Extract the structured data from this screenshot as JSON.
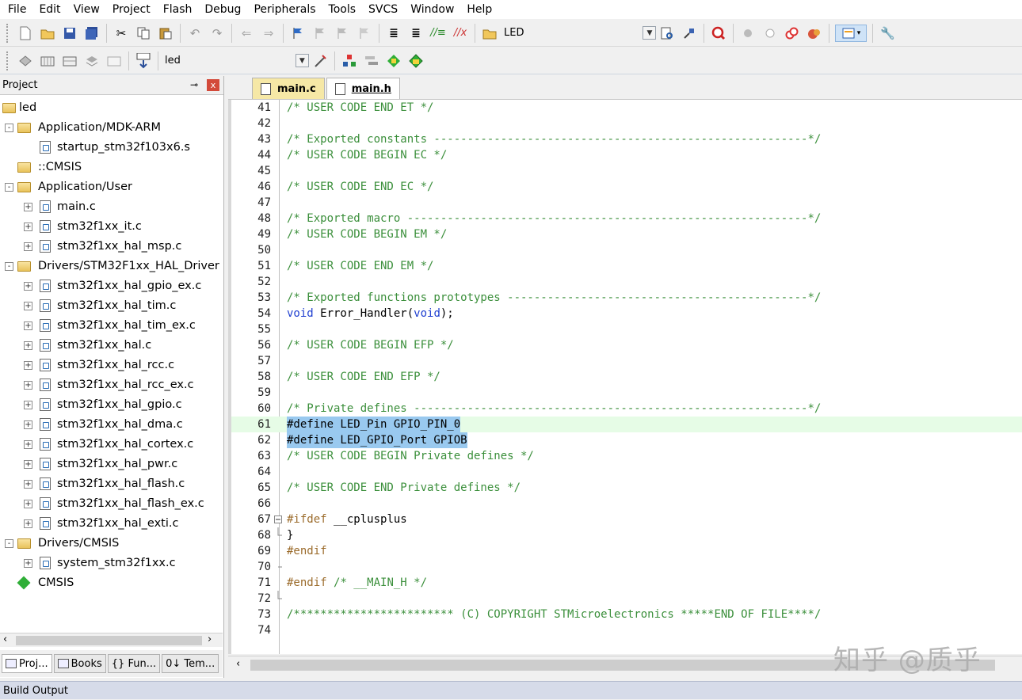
{
  "menu": [
    "File",
    "Edit",
    "View",
    "Project",
    "Flash",
    "Debug",
    "Peripherals",
    "Tools",
    "SVCS",
    "Window",
    "Help"
  ],
  "toolbar1": {
    "target_label": "LED"
  },
  "toolbar2": {
    "target_label": "led"
  },
  "project_panel": {
    "title": "Project",
    "pin": "ᵖ",
    "close": "x",
    "tree": [
      {
        "label": "led",
        "level": 0,
        "type": "root",
        "expander": ""
      },
      {
        "label": "Application/MDK-ARM",
        "level": 1,
        "type": "folder",
        "expander": "-"
      },
      {
        "label": "startup_stm32f103x6.s",
        "level": 2,
        "type": "file",
        "expander": ""
      },
      {
        "label": "::CMSIS",
        "level": 1,
        "type": "folder",
        "expander": ""
      },
      {
        "label": "Application/User",
        "level": 1,
        "type": "folder",
        "expander": "-"
      },
      {
        "label": "main.c",
        "level": 2,
        "type": "file",
        "expander": "+"
      },
      {
        "label": "stm32f1xx_it.c",
        "level": 2,
        "type": "file",
        "expander": "+"
      },
      {
        "label": "stm32f1xx_hal_msp.c",
        "level": 2,
        "type": "file",
        "expander": "+"
      },
      {
        "label": "Drivers/STM32F1xx_HAL_Driver",
        "level": 1,
        "type": "folder",
        "expander": "-"
      },
      {
        "label": "stm32f1xx_hal_gpio_ex.c",
        "level": 2,
        "type": "file",
        "expander": "+"
      },
      {
        "label": "stm32f1xx_hal_tim.c",
        "level": 2,
        "type": "file",
        "expander": "+"
      },
      {
        "label": "stm32f1xx_hal_tim_ex.c",
        "level": 2,
        "type": "file",
        "expander": "+"
      },
      {
        "label": "stm32f1xx_hal.c",
        "level": 2,
        "type": "file",
        "expander": "+"
      },
      {
        "label": "stm32f1xx_hal_rcc.c",
        "level": 2,
        "type": "file",
        "expander": "+"
      },
      {
        "label": "stm32f1xx_hal_rcc_ex.c",
        "level": 2,
        "type": "file",
        "expander": "+"
      },
      {
        "label": "stm32f1xx_hal_gpio.c",
        "level": 2,
        "type": "file",
        "expander": "+"
      },
      {
        "label": "stm32f1xx_hal_dma.c",
        "level": 2,
        "type": "file",
        "expander": "+"
      },
      {
        "label": "stm32f1xx_hal_cortex.c",
        "level": 2,
        "type": "file",
        "expander": "+"
      },
      {
        "label": "stm32f1xx_hal_pwr.c",
        "level": 2,
        "type": "file",
        "expander": "+"
      },
      {
        "label": "stm32f1xx_hal_flash.c",
        "level": 2,
        "type": "file",
        "expander": "+"
      },
      {
        "label": "stm32f1xx_hal_flash_ex.c",
        "level": 2,
        "type": "file",
        "expander": "+"
      },
      {
        "label": "stm32f1xx_hal_exti.c",
        "level": 2,
        "type": "file",
        "expander": "+"
      },
      {
        "label": "Drivers/CMSIS",
        "level": 1,
        "type": "folder",
        "expander": "-"
      },
      {
        "label": "system_stm32f1xx.c",
        "level": 2,
        "type": "file",
        "expander": "+"
      },
      {
        "label": "CMSIS",
        "level": 1,
        "type": "component",
        "expander": ""
      }
    ],
    "tabs": [
      "Proj...",
      "Books",
      "{} Fun...",
      "0↓ Tem..."
    ]
  },
  "editor": {
    "tabs": [
      {
        "label": "main.c",
        "active": false
      },
      {
        "label": "main.h",
        "active": true
      }
    ],
    "lines": [
      {
        "n": "41",
        "t": "/* USER CODE END ET */",
        "c": "cm"
      },
      {
        "n": "42",
        "t": "",
        "c": ""
      },
      {
        "n": "43",
        "t": "/* Exported constants --------------------------------------------------------*/",
        "c": "cm"
      },
      {
        "n": "44",
        "t": "/* USER CODE BEGIN EC */",
        "c": "cm"
      },
      {
        "n": "45",
        "t": "",
        "c": ""
      },
      {
        "n": "46",
        "t": "/* USER CODE END EC */",
        "c": "cm"
      },
      {
        "n": "47",
        "t": "",
        "c": ""
      },
      {
        "n": "48",
        "t": "/* Exported macro ------------------------------------------------------------*/",
        "c": "cm"
      },
      {
        "n": "49",
        "t": "/* USER CODE BEGIN EM */",
        "c": "cm"
      },
      {
        "n": "50",
        "t": "",
        "c": ""
      },
      {
        "n": "51",
        "t": "/* USER CODE END EM */",
        "c": "cm"
      },
      {
        "n": "52",
        "t": "",
        "c": ""
      },
      {
        "n": "53",
        "t": "/* Exported functions prototypes ---------------------------------------------*/",
        "c": "cm"
      },
      {
        "n": "54",
        "t": "void Error_Handler(void);",
        "c": "code"
      },
      {
        "n": "55",
        "t": "",
        "c": ""
      },
      {
        "n": "56",
        "t": "/* USER CODE BEGIN EFP */",
        "c": "cm"
      },
      {
        "n": "57",
        "t": "",
        "c": ""
      },
      {
        "n": "58",
        "t": "/* USER CODE END EFP */",
        "c": "cm"
      },
      {
        "n": "59",
        "t": "",
        "c": ""
      },
      {
        "n": "60",
        "t": "/* Private defines -----------------------------------------------------------*/",
        "c": "cm"
      },
      {
        "n": "61",
        "t": "#define LED_Pin GPIO_PIN_0",
        "c": "sel cur"
      },
      {
        "n": "62",
        "t": "#define LED_GPIO_Port GPIOB",
        "c": "sel"
      },
      {
        "n": "63",
        "t": "/* USER CODE BEGIN Private defines */",
        "c": "cm"
      },
      {
        "n": "64",
        "t": "",
        "c": ""
      },
      {
        "n": "65",
        "t": "/* USER CODE END Private defines */",
        "c": "cm"
      },
      {
        "n": "66",
        "t": "",
        "c": ""
      },
      {
        "n": "67",
        "t": "#ifdef __cplusplus",
        "c": "pp"
      },
      {
        "n": "68",
        "t": "}",
        "c": ""
      },
      {
        "n": "69",
        "t": "#endif",
        "c": "pp"
      },
      {
        "n": "70",
        "t": "",
        "c": ""
      },
      {
        "n": "71",
        "t": "#endif /* __MAIN_H */",
        "c": "pp"
      },
      {
        "n": "72",
        "t": "",
        "c": ""
      },
      {
        "n": "73",
        "t": "/************************ (C) COPYRIGHT STMicroelectronics *****END OF FILE****/",
        "c": "cm"
      },
      {
        "n": "74",
        "t": "",
        "c": ""
      }
    ]
  },
  "build_output": "Build Output",
  "watermark": "知乎 @质乎"
}
